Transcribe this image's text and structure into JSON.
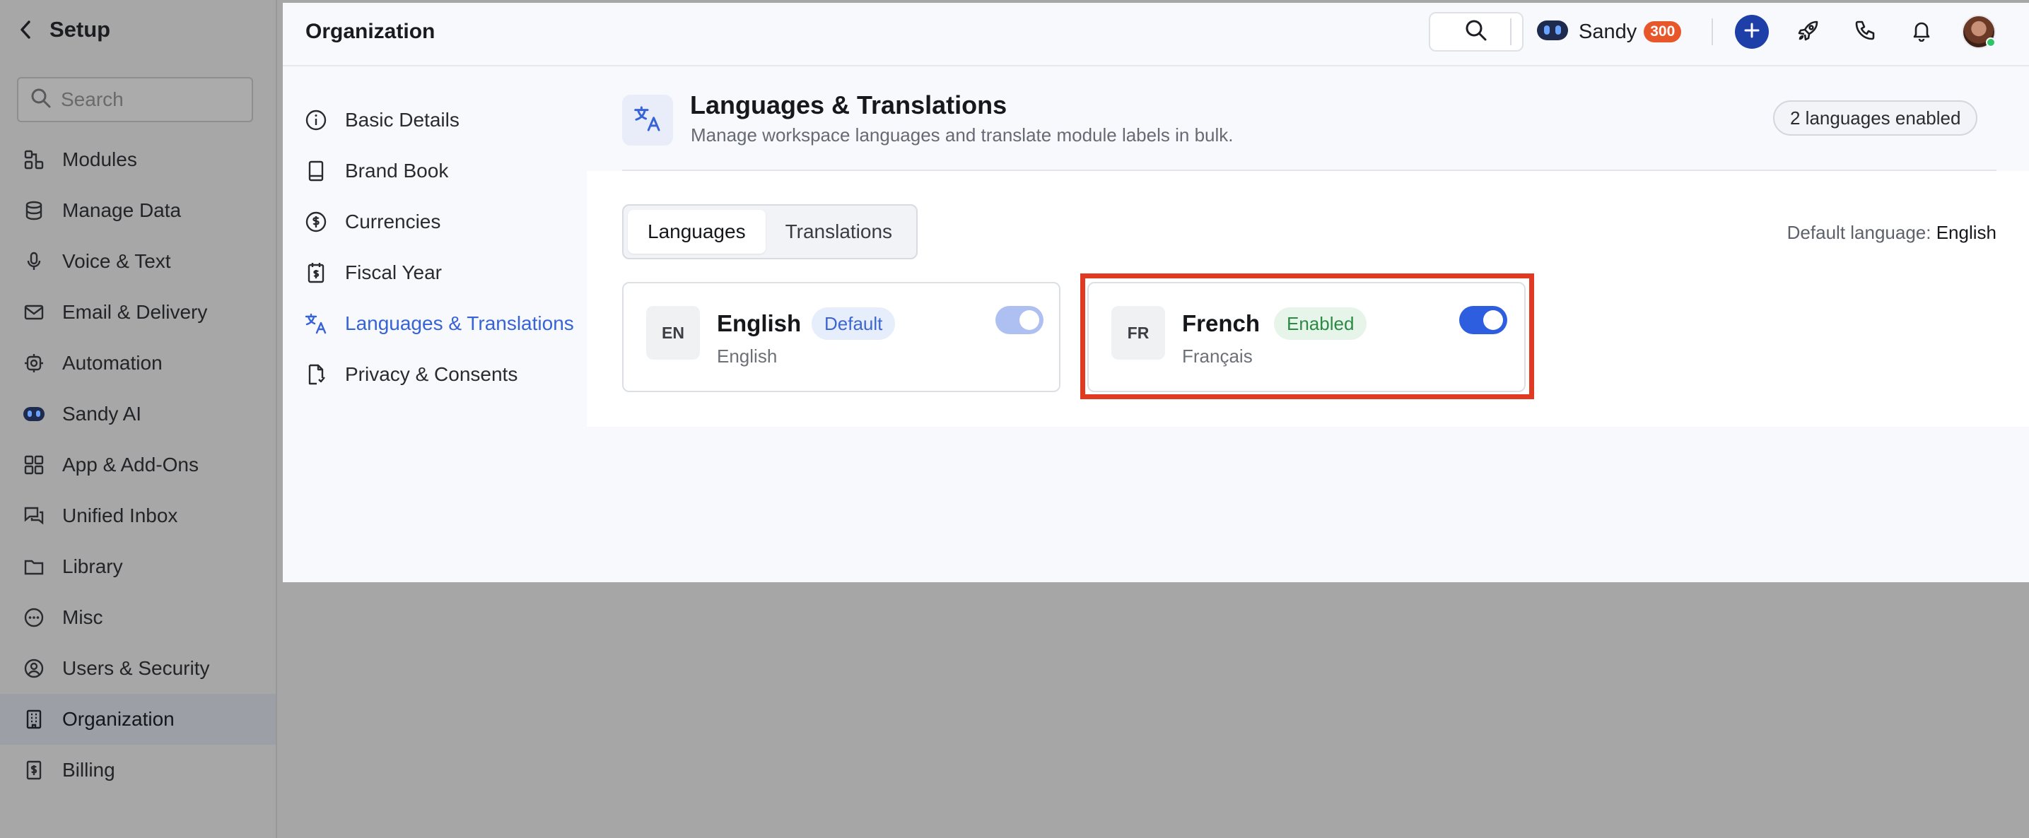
{
  "sidebar": {
    "title": "Setup",
    "search_placeholder": "Search",
    "items": [
      {
        "label": "Modules",
        "icon": "modules-icon"
      },
      {
        "label": "Manage Data",
        "icon": "database-icon"
      },
      {
        "label": "Voice & Text",
        "icon": "microphone-icon"
      },
      {
        "label": "Email & Delivery",
        "icon": "envelope-icon"
      },
      {
        "label": "Automation",
        "icon": "automation-icon"
      },
      {
        "label": "Sandy AI",
        "icon": "robot-icon"
      },
      {
        "label": "App & Add-Ons",
        "icon": "apps-grid-icon"
      },
      {
        "label": "Unified Inbox",
        "icon": "chat-bubbles-icon"
      },
      {
        "label": "Library",
        "icon": "folder-icon"
      },
      {
        "label": "Misc",
        "icon": "more-circle-icon"
      },
      {
        "label": "Users & Security",
        "icon": "user-circle-icon"
      },
      {
        "label": "Organization",
        "icon": "building-icon",
        "active": true
      },
      {
        "label": "Billing",
        "icon": "billing-icon"
      }
    ]
  },
  "topbar": {
    "title": "Organization",
    "assistant_name": "Sandy",
    "credit_badge": "300"
  },
  "subnav": {
    "items": [
      {
        "label": "Basic Details",
        "icon": "info-icon"
      },
      {
        "label": "Brand Book",
        "icon": "book-icon"
      },
      {
        "label": "Currencies",
        "icon": "currency-icon"
      },
      {
        "label": "Fiscal Year",
        "icon": "calendar-icon"
      },
      {
        "label": "Languages & Translations",
        "icon": "translate-icon",
        "active": true
      },
      {
        "label": "Privacy & Consents",
        "icon": "document-icon"
      }
    ]
  },
  "page": {
    "title": "Languages & Translations",
    "subtitle": "Manage workspace languages and translate module labels in bulk.",
    "count_label": "2 languages enabled",
    "tabs": [
      "Languages",
      "Translations"
    ],
    "active_tab": "Languages",
    "default_language_label": "Default language:",
    "default_language_value": "English"
  },
  "languages": [
    {
      "code": "EN",
      "name": "English",
      "native": "English",
      "badge": "Default",
      "enabled": true,
      "locked": true
    },
    {
      "code": "FR",
      "name": "French",
      "native": "Français",
      "badge": "Enabled",
      "enabled": true,
      "locked": false
    }
  ],
  "colors": {
    "accent": "#2e5ee0",
    "active_nav": "#3763d8",
    "highlight": "#e03a22",
    "badge_orange": "#e8572a"
  }
}
